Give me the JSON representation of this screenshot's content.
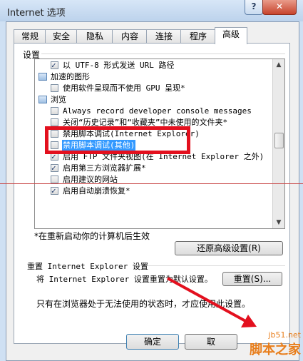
{
  "window": {
    "title": "Internet 选项",
    "help": "?",
    "close": "✕"
  },
  "tabs": [
    "常规",
    "安全",
    "隐私",
    "内容",
    "连接",
    "程序",
    "高级"
  ],
  "settings": {
    "group_label": "设置",
    "rows": [
      {
        "type": "checkbox",
        "checked": true,
        "text": "以 UTF-8 形式发送 URL 路径"
      },
      {
        "type": "category",
        "text": "加速的图形"
      },
      {
        "type": "checkbox",
        "checked": false,
        "text": "使用软件呈现而不使用 GPU 呈现*"
      },
      {
        "type": "category",
        "text": "浏览"
      },
      {
        "type": "checkbox",
        "checked": false,
        "text": "Always record developer console messages"
      },
      {
        "type": "checkbox",
        "checked": false,
        "text": "关闭“历史记录”和“收藏夹”中未使用的文件夹*"
      },
      {
        "type": "checkbox",
        "checked": false,
        "text": "禁用脚本调试(Internet Explorer)"
      },
      {
        "type": "checkbox",
        "checked": false,
        "text": "禁用脚本调试(其他)",
        "selected": true
      },
      {
        "type": "checkbox",
        "checked": true,
        "text": "启用 FTP 文件夹视图(在 Internet Explorer 之外)"
      },
      {
        "type": "checkbox",
        "checked": true,
        "text": "启用第三方浏览器扩展*"
      },
      {
        "type": "checkbox",
        "checked": false,
        "text": "启用建议的网站"
      },
      {
        "type": "checkbox",
        "checked": true,
        "text": "启用自动崩溃恢复*"
      }
    ]
  },
  "restart_note": "*在重新启动你的计算机后生效",
  "restore_button": "还原高级设置(R)",
  "reset": {
    "label": "重置 Internet Explorer 设置",
    "description": "将 Internet Explorer 设置重置为默认设置。",
    "button": "重置(S)...",
    "note": "只有在浏览器处于无法使用的状态时，才应使用此设置。"
  },
  "footer": {
    "ok": "确定",
    "cancel": "取"
  },
  "watermark": {
    "site": "jb51.net",
    "brand": "脚本之家"
  },
  "colors": {
    "highlight": "#e3101e",
    "selection": "#3399ff",
    "watermark": "#e87e1c"
  }
}
